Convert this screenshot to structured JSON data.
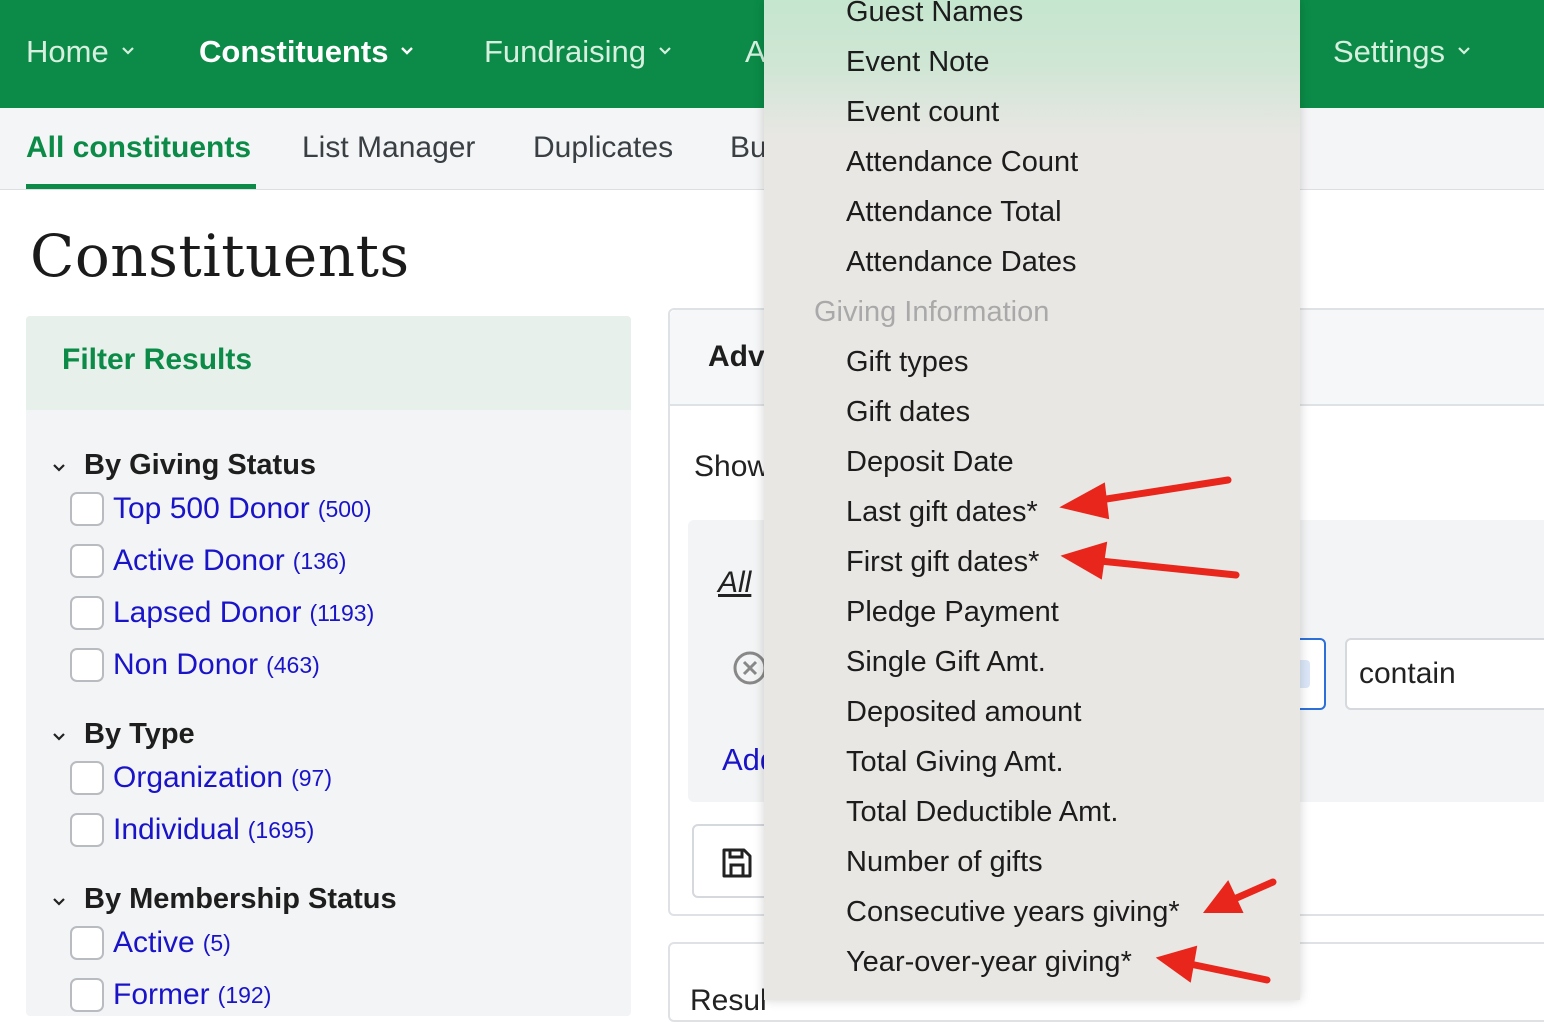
{
  "topnav": {
    "items": [
      {
        "label": "Home",
        "active": false
      },
      {
        "label": "Constituents",
        "active": true
      },
      {
        "label": "Fundraising",
        "active": false
      },
      {
        "label": "A",
        "active": false
      },
      {
        "label": "Settings",
        "active": false
      }
    ],
    "bg_color": "#0b8b47"
  },
  "subnav": {
    "items": [
      {
        "label": "All constituents",
        "active": true
      },
      {
        "label": "List Manager",
        "active": false
      },
      {
        "label": "Duplicates",
        "active": false
      },
      {
        "label": "Bu",
        "active": false
      }
    ]
  },
  "page": {
    "title": "Constituents"
  },
  "filter": {
    "title": "Filter Results",
    "groups": [
      {
        "title": "By Giving Status",
        "options": [
          {
            "label": "Top 500 Donor",
            "count": "(500)"
          },
          {
            "label": "Active Donor",
            "count": "(136)"
          },
          {
            "label": "Lapsed Donor",
            "count": "(1193)"
          },
          {
            "label": "Non Donor",
            "count": "(463)"
          }
        ]
      },
      {
        "title": "By Type",
        "options": [
          {
            "label": "Organization",
            "count": "(97)"
          },
          {
            "label": "Individual",
            "count": "(1695)"
          }
        ]
      },
      {
        "title": "By Membership Status",
        "options": [
          {
            "label": "Active",
            "count": "(5)"
          },
          {
            "label": "Former",
            "count": "(192)"
          }
        ]
      }
    ]
  },
  "advanced": {
    "title": "Adv",
    "show_label": "Show",
    "all_link": "All",
    "add_link": "Add",
    "operator_value": "contain",
    "results_label": "Resul"
  },
  "dropdown": {
    "items_top": [
      "Guest Names",
      "Event Note",
      "Event count",
      "Attendance Count",
      "Attendance Total",
      "Attendance Dates"
    ],
    "group_label": "Giving Information",
    "items_giving": [
      "Gift types",
      "Gift dates",
      "Deposit Date",
      "Last gift dates*",
      "First gift dates*",
      "Pledge Payment",
      "Single Gift Amt.",
      "Deposited amount",
      "Total Giving Amt.",
      "Total Deductible Amt.",
      "Number of gifts",
      "Consecutive years giving*",
      "Year-over-year giving*"
    ],
    "highlighted_items": [
      "Last gift dates*",
      "First gift dates*",
      "Consecutive years giving*",
      "Year-over-year giving*"
    ],
    "annotation_color": "#e8261c"
  },
  "colors": {
    "brand_green": "#0b8b47",
    "link_blue": "#1a14c8",
    "focus_blue": "#2c6fd8"
  }
}
